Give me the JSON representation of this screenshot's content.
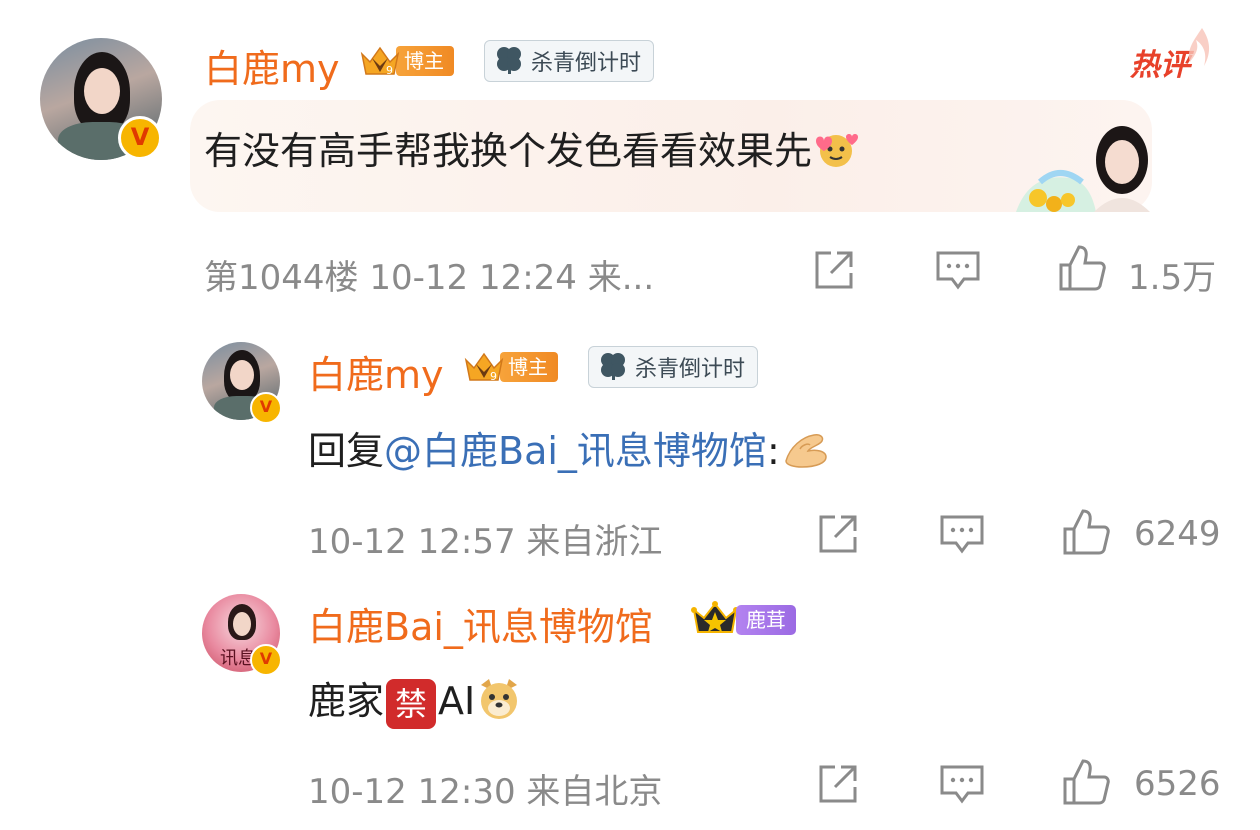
{
  "hot_label": "热评",
  "comments": [
    {
      "username": "白鹿my",
      "blogger_badge": "博主",
      "countdown_badge": "杀青倒计时",
      "text": "有没有高手帮我换个发色看看效果先",
      "meta": "第1044楼 10-12 12:24 来...",
      "likes": "1.5万"
    },
    {
      "username": "白鹿my",
      "blogger_badge": "博主",
      "countdown_badge": "杀青倒计时",
      "reply_prefix": "回复",
      "mention": "@白鹿Bai_讯息博物馆",
      "reply_suffix": ":",
      "meta": "10-12 12:57 来自浙江",
      "likes": "6249"
    },
    {
      "username": "白鹿Bai_讯息博物馆",
      "fan_badge": "鹿茸",
      "text_before": "鹿家",
      "ban_char": "禁",
      "text_after": "AI",
      "meta": "10-12 12:30 来自北京",
      "likes": "6526",
      "avatar_text": "讯息"
    }
  ],
  "colors": {
    "username": "#f06b1c",
    "mention": "#3a6fb6",
    "meta": "#8a8a8a",
    "hot": "#e8412a"
  }
}
